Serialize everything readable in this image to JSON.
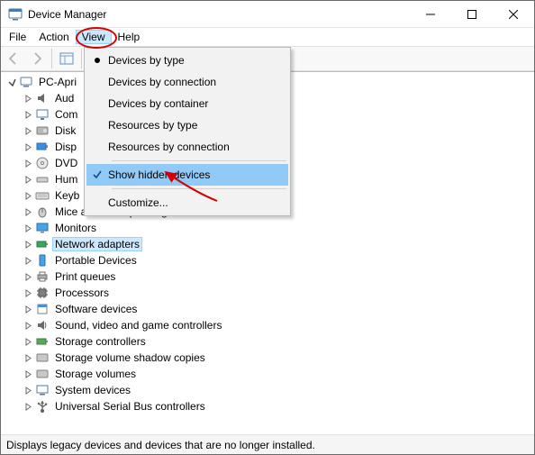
{
  "window": {
    "title": "Device Manager"
  },
  "menu": {
    "file": "File",
    "action": "Action",
    "view": "View",
    "help": "Help"
  },
  "viewMenu": {
    "devicesByType": "Devices by type",
    "devicesByConnection": "Devices by connection",
    "devicesByContainer": "Devices by container",
    "resourcesByType": "Resources by type",
    "resourcesByConnection": "Resources by connection",
    "showHidden": "Show hidden devices",
    "customize": "Customize..."
  },
  "tree": {
    "root": "PC-Apri",
    "items": [
      "Aud",
      "Com",
      "Disk",
      "Disp",
      "DVD",
      "Hum",
      "Keyb",
      "Mice and other pointing devices",
      "Monitors",
      "Network adapters",
      "Portable Devices",
      "Print queues",
      "Processors",
      "Software devices",
      "Sound, video and game controllers",
      "Storage controllers",
      "Storage volume shadow copies",
      "Storage volumes",
      "System devices",
      "Universal Serial Bus controllers"
    ]
  },
  "status": {
    "text": "Displays legacy devices and devices that are no longer installed."
  }
}
